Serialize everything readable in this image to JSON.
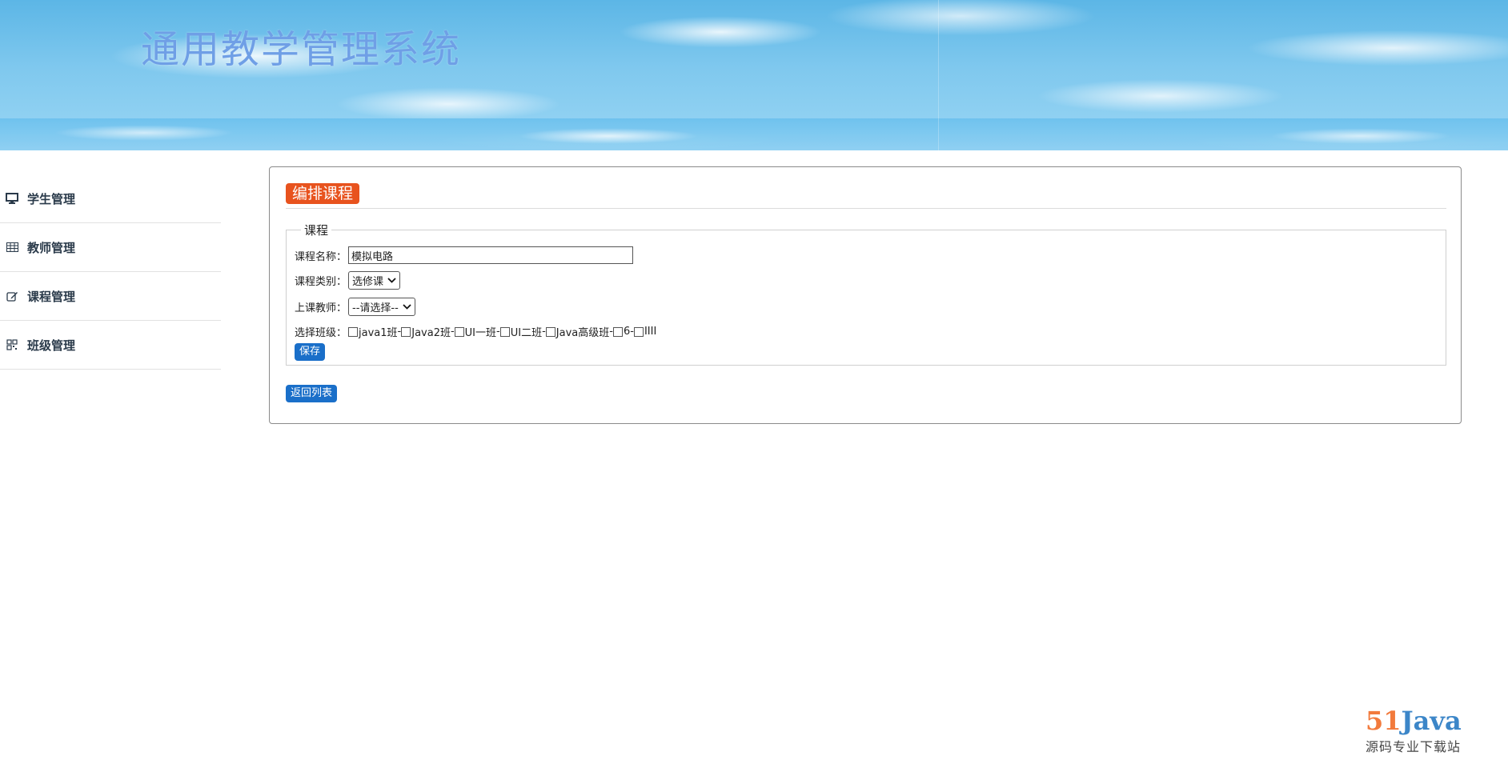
{
  "header": {
    "app_title": "通用教学管理系统"
  },
  "sidebar": {
    "items": [
      {
        "label": "学生管理",
        "icon": "monitor-icon"
      },
      {
        "label": "教师管理",
        "icon": "table-icon"
      },
      {
        "label": "课程管理",
        "icon": "edit-icon"
      },
      {
        "label": "班级管理",
        "icon": "grid-icon"
      }
    ]
  },
  "main": {
    "panel_title": "编排课程",
    "fieldset_legend": "课程",
    "form": {
      "name_label": "课程名称：",
      "name_value": "模拟电路",
      "type_label": "课程类别：",
      "type_value": "选修课",
      "teacher_label": "上课教师：",
      "teacher_value": "--请选择--",
      "class_label": "选择班级：",
      "classes": [
        "java1班",
        "Java2班",
        "UI一班",
        "UI二班",
        "Java高级班",
        "6",
        "IIII"
      ],
      "separator": "-",
      "save_label": "保存"
    },
    "back_label": "返回列表"
  },
  "watermark": {
    "brand_num": "51",
    "brand_text": "Java",
    "subtitle": "源码专业下载站"
  },
  "colors": {
    "title_badge": "#e8531e",
    "primary_button": "#1a6fc9",
    "header_title": "#6f9fe6"
  }
}
